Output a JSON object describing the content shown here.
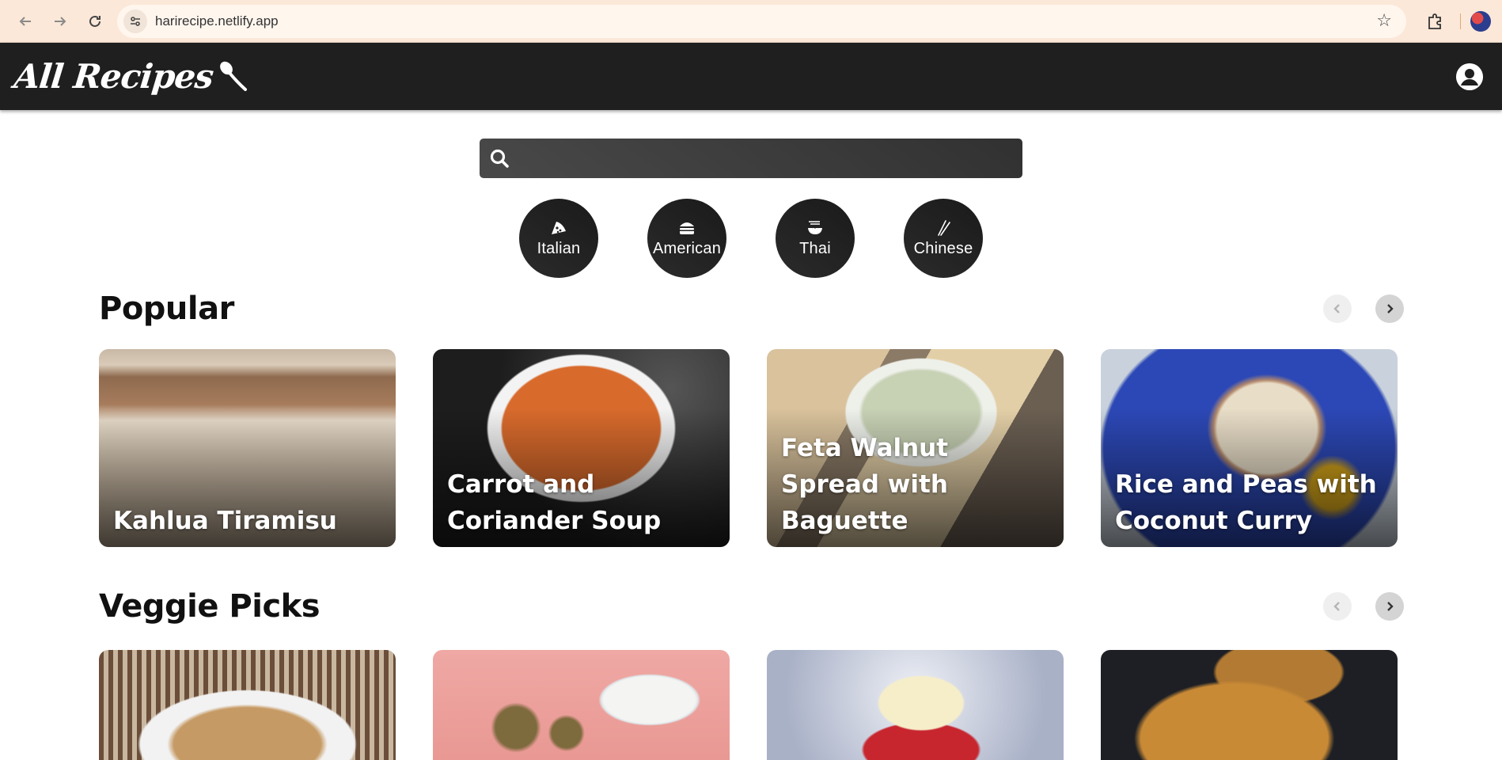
{
  "browser": {
    "url": "harirecipe.netlify.app"
  },
  "header": {
    "logo_text": "All Recipes"
  },
  "search": {
    "placeholder": "",
    "value": ""
  },
  "categories": [
    {
      "label": "Italian",
      "icon": "pizza-icon"
    },
    {
      "label": "American",
      "icon": "burger-icon"
    },
    {
      "label": "Thai",
      "icon": "noodle-bowl-icon"
    },
    {
      "label": "Chinese",
      "icon": "chopsticks-icon"
    }
  ],
  "sections": [
    {
      "title": "Popular",
      "cards": [
        {
          "title": "Kahlua Tiramisu"
        },
        {
          "title": "Carrot and Coriander Soup"
        },
        {
          "title": "Feta Walnut Spread with Baguette"
        },
        {
          "title": "Rice and Peas with Coconut Curry"
        }
      ]
    },
    {
      "title": "Veggie Picks",
      "cards": [
        {
          "title": ""
        },
        {
          "title": ""
        },
        {
          "title": ""
        },
        {
          "title": ""
        }
      ]
    }
  ],
  "colors": {
    "header_bg": "#1f1f1f",
    "browser_bar": "#fce8d8",
    "accent_dark": "#313131"
  }
}
